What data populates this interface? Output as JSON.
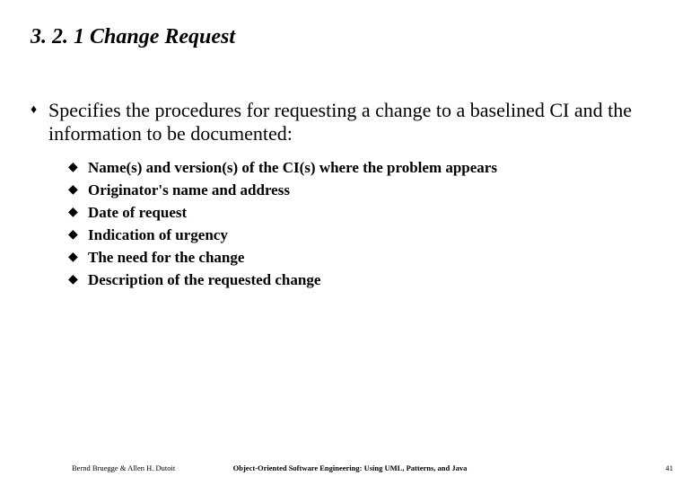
{
  "title": "3. 2. 1 Change Request",
  "lvl1_text": "Specifies the procedures for requesting a change to a baselined CI and the information to be documented:",
  "lvl2": [
    "Name(s) and version(s) of the CI(s) where the problem appears",
    "Originator's name and address",
    "Date of request",
    "Indication of urgency",
    "The need for the change",
    "Description of the requested change"
  ],
  "footer": {
    "left": "Bernd Bruegge & Allen H. Dutoit",
    "center": "Object-Oriented Software Engineering: Using UML, Patterns, and Java",
    "right": "41"
  },
  "bullet_lvl1": "♦",
  "bullet_lvl2": "◆"
}
